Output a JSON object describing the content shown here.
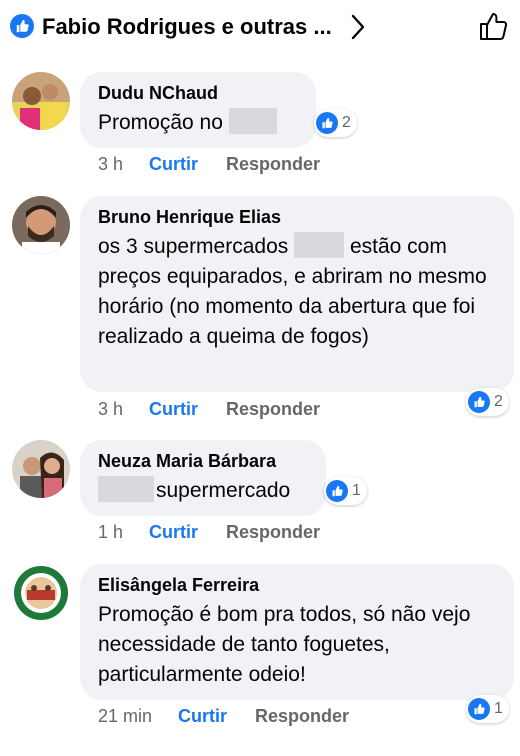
{
  "header": {
    "title": "Fabio Rodrigues e outras ...",
    "icons": [
      "like-reaction-icon",
      "chevron-right-icon",
      "thumbs-up-outline-icon"
    ]
  },
  "actions": {
    "like": "Curtir",
    "reply": "Responder"
  },
  "colors": {
    "accent": "#1877f2",
    "bubble": "#f0f2f5",
    "muted": "#65676b"
  },
  "comments": [
    {
      "author": "Dudu NChaud",
      "text_before": "Promoção no",
      "time": "3 h",
      "reactions": "2"
    },
    {
      "author": "Bruno Henrique Elias",
      "text_before": "os 3 supermercados",
      "text_after": "estão com preços equiparados, e abriram no mesmo horário (no momento da abertura que foi realizado a queima de fogos)",
      "time": "3 h",
      "reactions": "2"
    },
    {
      "author": "Neuza Maria Bárbara",
      "text_after": "supermercado",
      "time": "1 h",
      "reactions": "1"
    },
    {
      "author": "Elisângela Ferreira",
      "text_before": "Promoção é bom pra todos, só não vejo necessidade de tanto foguetes, particularmente odeio!",
      "time": "21 min",
      "reactions": "1"
    }
  ]
}
